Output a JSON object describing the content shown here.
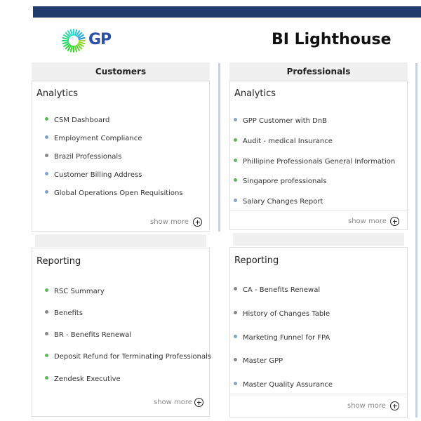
{
  "header": {
    "brand": "GP",
    "title": "BI Lighthouse"
  },
  "colors": {
    "topbar": "#1f3c6c",
    "dot_green": "#5cb85c",
    "dot_blue": "#7fa3c8",
    "dot_gray": "#888888"
  },
  "customers": {
    "header": "Customers",
    "analytics": {
      "title": "Analytics",
      "items": [
        {
          "label": "CSM Dashboard",
          "dot": "green"
        },
        {
          "label": "Employment Compliance",
          "dot": "blue"
        },
        {
          "label": "Brazil Professionals",
          "dot": "gray"
        },
        {
          "label": "Customer Billing Address",
          "dot": "blue"
        },
        {
          "label": "Global Operations Open Requisitions",
          "dot": "blue"
        }
      ],
      "show_more": "show more"
    },
    "reporting": {
      "title": "Reporting",
      "items": [
        {
          "label": "RSC Summary",
          "dot": "green"
        },
        {
          "label": "Benefits",
          "dot": "gray"
        },
        {
          "label": "BR - Benefits Renewal",
          "dot": "gray"
        },
        {
          "label": "Deposit Refund for Terminating Professionals",
          "dot": "green"
        },
        {
          "label": "Zendesk Executive",
          "dot": "green"
        }
      ],
      "show_more": "show more"
    }
  },
  "professionals": {
    "header": "Professionals",
    "analytics": {
      "title": "Analytics",
      "items": [
        {
          "label": "GPP Customer with DnB",
          "dot": "blue"
        },
        {
          "label": "Audit - medical Insurance",
          "dot": "green"
        },
        {
          "label": "Phillipine Professionals General Information",
          "dot": "green"
        },
        {
          "label": "Singapore professionals",
          "dot": "green"
        },
        {
          "label": "Salary Changes Report",
          "dot": "blue"
        }
      ],
      "show_more": "show more"
    },
    "reporting": {
      "title": "Reporting",
      "items": [
        {
          "label": "CA - Benefits Renewal",
          "dot": "gray"
        },
        {
          "label": "History of Changes Table",
          "dot": "gray"
        },
        {
          "label": "Marketing Funnel for FPA",
          "dot": "blue"
        },
        {
          "label": "Master GPP",
          "dot": "gray"
        },
        {
          "label": "Master Quality Assurance",
          "dot": "blue"
        }
      ],
      "show_more": "show more"
    }
  }
}
